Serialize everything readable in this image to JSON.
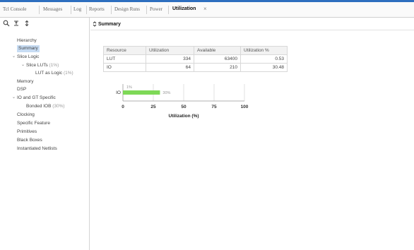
{
  "tabs": [
    {
      "label": "Tcl Console",
      "active": false
    },
    {
      "label": "Messages",
      "active": false
    },
    {
      "label": "Log",
      "active": false
    },
    {
      "label": "Reports",
      "active": false
    },
    {
      "label": "Design Runs",
      "active": false
    },
    {
      "label": "Power",
      "active": false
    },
    {
      "label": "Utilization",
      "active": true
    }
  ],
  "tab_close_glyph": "×",
  "sidebar": {
    "items": [
      {
        "label": "Hierarchy",
        "pct": ""
      },
      {
        "label": "Summary",
        "pct": ""
      },
      {
        "label": "Slice Logic",
        "pct": ""
      },
      {
        "label": "Slice LUTs",
        "pct": "(1%)"
      },
      {
        "label": "LUT as Logic",
        "pct": "(1%)"
      },
      {
        "label": "Memory",
        "pct": ""
      },
      {
        "label": "DSP",
        "pct": ""
      },
      {
        "label": "IO and GT Specific",
        "pct": ""
      },
      {
        "label": "Bonded IOB",
        "pct": "(30%)"
      },
      {
        "label": "Clocking",
        "pct": ""
      },
      {
        "label": "Specific Feature",
        "pct": ""
      },
      {
        "label": "Primitives",
        "pct": ""
      },
      {
        "label": "Black Boxes",
        "pct": ""
      },
      {
        "label": "Instantiated Netlists",
        "pct": ""
      }
    ]
  },
  "summary": {
    "title": "Summary",
    "table": {
      "headers": [
        "Resource",
        "Utilization",
        "Available",
        "Utilization %"
      ],
      "rows": [
        [
          "LUT",
          "334",
          "63400",
          "0.53"
        ],
        [
          "IO",
          "64",
          "210",
          "30.48"
        ]
      ]
    }
  },
  "colors": {
    "accent": "#2e6fbf",
    "bar": "#7ed957",
    "selection": "#c7dcf3"
  },
  "chart_data": {
    "type": "bar",
    "orientation": "horizontal",
    "categories": [
      "IO"
    ],
    "values": [
      30.48
    ],
    "data_labels": [
      "30%"
    ],
    "extra_annotation": "1%",
    "xlabel": "Utilization (%)",
    "xticks": [
      "0",
      "25",
      "50",
      "75",
      "100"
    ],
    "xlim": [
      0,
      100
    ],
    "grid": true
  }
}
